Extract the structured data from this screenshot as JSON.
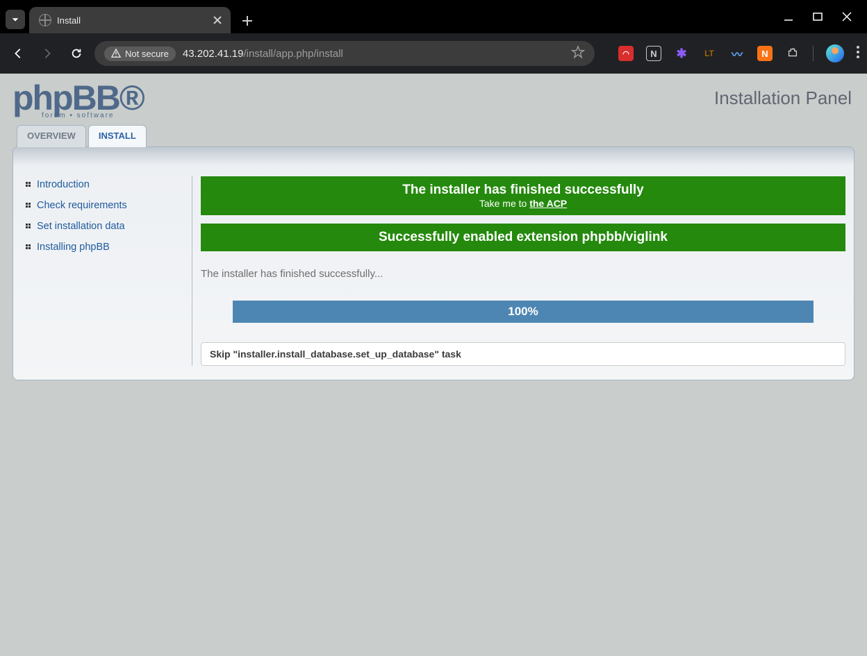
{
  "browser": {
    "tab_title": "Install",
    "not_secure_label": "Not secure",
    "url_host": "43.202.41.19",
    "url_path": "/install/app.php/install"
  },
  "header": {
    "logo_text": "phpBB",
    "logo_sub": "forum ▪ software",
    "panel_title": "Installation Panel"
  },
  "tabs": {
    "overview": "OVERVIEW",
    "install": "INSTALL"
  },
  "sidebar": {
    "links": [
      "Introduction",
      "Check requirements",
      "Set installation data",
      "Installing phpBB"
    ]
  },
  "messages": {
    "finished_title": "The installer has finished successfully",
    "take_me_to": "Take me to ",
    "acp_link": "the ACP",
    "ext_enabled": "Successfully enabled extension phpbb/viglink",
    "status_line": "The installer has finished successfully...",
    "progress": "100%",
    "log": "Skip \"installer.install_database.set_up_database\" task"
  }
}
